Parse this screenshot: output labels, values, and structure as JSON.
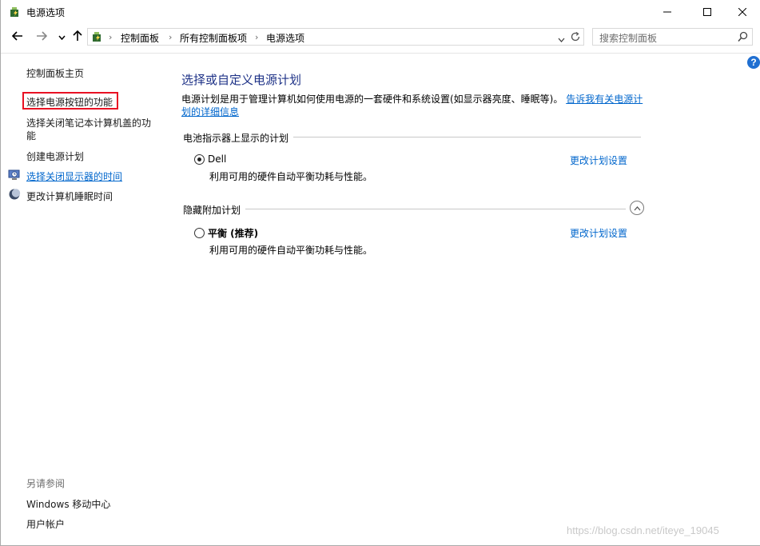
{
  "window": {
    "title": "电源选项",
    "icon": "power-options-icon",
    "controls": [
      "minimize-icon",
      "maximize-icon",
      "close-icon"
    ]
  },
  "navigation": {
    "back": "back-arrow-icon",
    "forward": "forward-arrow-icon",
    "recent": "chevron-down-icon",
    "up": "up-arrow-icon",
    "breadcrumbs": [
      "控制面板",
      "所有控制面板项",
      "电源选项"
    ],
    "search_placeholder": "搜索控制面板"
  },
  "sidebar": {
    "items": [
      {
        "label": "控制面板主页"
      },
      {
        "label": "选择电源按钮的功能"
      },
      {
        "label": "选择关闭笔记本计算机盖的功",
        "label2": "能"
      },
      {
        "label": "创建电源计划"
      },
      {
        "label": "选择关闭显示器的时间"
      },
      {
        "label": "更改计算机睡眠时间"
      }
    ],
    "see_also_label": "另请参阅",
    "see_also": [
      "Windows 移动中心",
      "用户帐户"
    ]
  },
  "main": {
    "heading": "选择或自定义电源计划",
    "description": "电源计划是用于管理计算机如何使用电源的一套硬件和系统设置(如显示器亮度、睡眠等)。",
    "description_link_line1": "告诉我有关电源计",
    "description_link_line2": "划的详细信息",
    "groups": [
      {
        "title": "电池指示器上显示的计划",
        "plan": {
          "name": "Dell",
          "desc": "利用可用的硬件自动平衡功耗与性能。",
          "selected": true,
          "link": "更改计划设置"
        }
      },
      {
        "title": "隐藏附加计划",
        "plan": {
          "name": "平衡 (推荐)",
          "desc": "利用可用的硬件自动平衡功耗与性能。",
          "selected": false,
          "link": "更改计划设置"
        }
      }
    ]
  },
  "help_label": "?",
  "watermark": "https://blog.csdn.net/iteye_19045",
  "colors": {
    "heading": "#1e3287",
    "link": "#0066cc",
    "highlight_box": "#e81123",
    "help": "#1f6fd1"
  }
}
